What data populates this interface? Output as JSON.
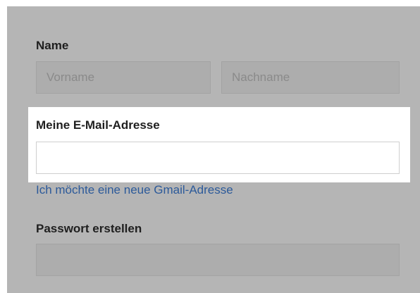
{
  "name_section": {
    "label": "Name",
    "first_name_placeholder": "Vorname",
    "last_name_placeholder": "Nachname"
  },
  "email_section": {
    "label": "Meine E-Mail-Adresse",
    "value": "",
    "gmail_link": "Ich möchte eine neue Gmail-Adresse"
  },
  "password_section": {
    "label": "Passwort erstellen",
    "value": ""
  },
  "colors": {
    "overlay_bg": "#b5b5b5",
    "highlight_bg": "#ffffff",
    "link": "#2c5a9a"
  }
}
